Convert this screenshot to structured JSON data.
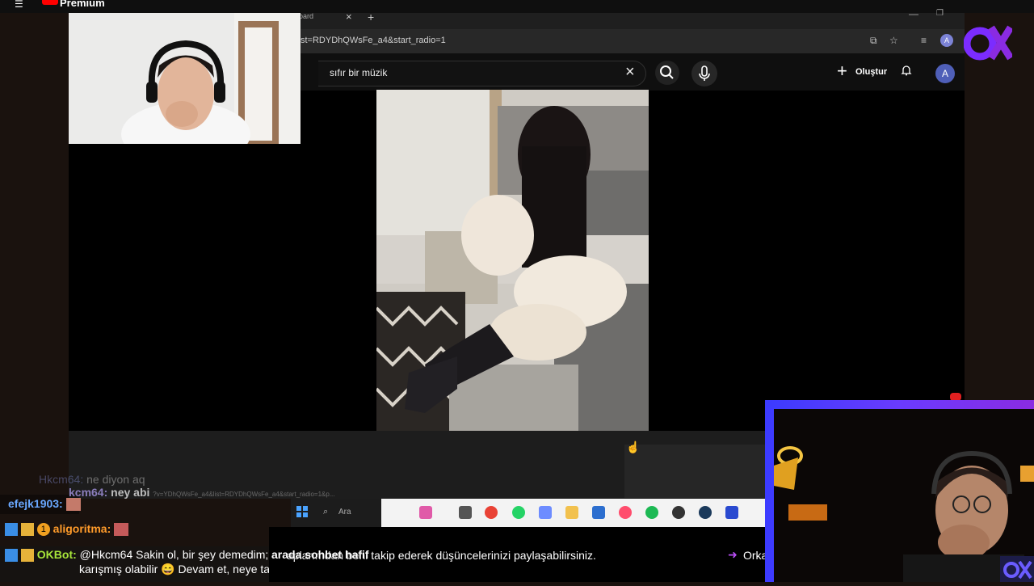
{
  "header": {
    "premium_label": "Premium"
  },
  "browser": {
    "tab_title": "oard",
    "url": "st=RDYDhQWsFe_a4&start_radio=1",
    "search_value": "sıfır bir müzik",
    "create_label": "Oluştur",
    "avatar_letter": "A",
    "profile_letter": "A"
  },
  "taskbar": {
    "search_label": "Ara"
  },
  "chat": {
    "lines": [
      {
        "user": "Hkcm64:",
        "text": "ne diyon aq"
      },
      {
        "user": "kcm64:",
        "text": "ney abi"
      },
      {
        "user": "efejk1903:",
        "text": ""
      },
      {
        "user": "aligoritma:",
        "text": ""
      },
      {
        "user": "OKBot:",
        "text": "@Hkcm64 Sakin ol, bir şey demedim;",
        "text2": "karışmış olabilir 😄 Devam et, neye takıldın?"
      }
    ],
    "badge_number": "1",
    "url_overlay": "?v=YDhQWsFe_a4&list=RDYDhQWsFe_a4&start_radio=1&p..."
  },
  "ticker": {
    "text": "aplarımdan beni takip ederek düşüncelerinizi paylaşabilirsiniz.",
    "next": "Orka",
    "overlay": "arada sohbet hafif"
  },
  "colors": {
    "accent": "#7b3cff",
    "ox_purple": "#8a2be2",
    "okbot_green": "#a8e63a",
    "efejk_blue": "#6aa8ff",
    "aligoritma_orange": "#ff9b2a"
  }
}
